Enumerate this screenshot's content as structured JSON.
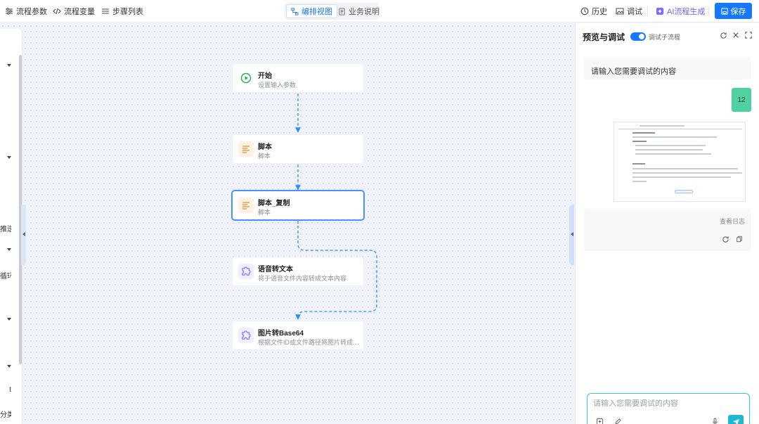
{
  "toolbar": {
    "flow_params": "流程参数",
    "flow_vars": "流程变量",
    "step_list": "步骤列表",
    "view_tabs": [
      {
        "label": "编排视图",
        "active": true
      },
      {
        "label": "业务说明",
        "active": false
      }
    ],
    "history": "历史",
    "debug": "调试",
    "ai_generate": "AI流程生成",
    "save": "保存"
  },
  "left_panel": {
    "partial_labels": [
      "推送",
      "循环",
      "t",
      "分类"
    ]
  },
  "nodes": [
    {
      "title": "开始",
      "desc": "设置输入参数",
      "icon": "play-circle-icon"
    },
    {
      "title": "脚本",
      "desc": "脚本",
      "icon": "script-icon"
    },
    {
      "title": "脚本_复制",
      "desc": "脚本",
      "icon": "script-icon"
    },
    {
      "title": "语音转文本",
      "desc": "将于语音文件内容转成文本内容",
      "icon": "plugin-icon"
    },
    {
      "title": "图片转Base64",
      "desc": "根据文件ID或文件路径将图片转成Ba...",
      "icon": "plugin-icon"
    }
  ],
  "debug_panel": {
    "title": "预览与调试",
    "toggle_label": "调试子流程",
    "toggle_on": true,
    "system_prompt": "请输入您需要调试的内容",
    "user_message": "12",
    "view_log": "查看日志",
    "input_placeholder": "请输入您需要调试的内容"
  },
  "colors": {
    "primary": "#1677ff",
    "accent_teal": "#1fb8d4",
    "user_bubble": "#4fd1a1",
    "ai_purple": "#6b5cff",
    "start_green": "#22b04b",
    "script_orange": "#f59a4a"
  }
}
